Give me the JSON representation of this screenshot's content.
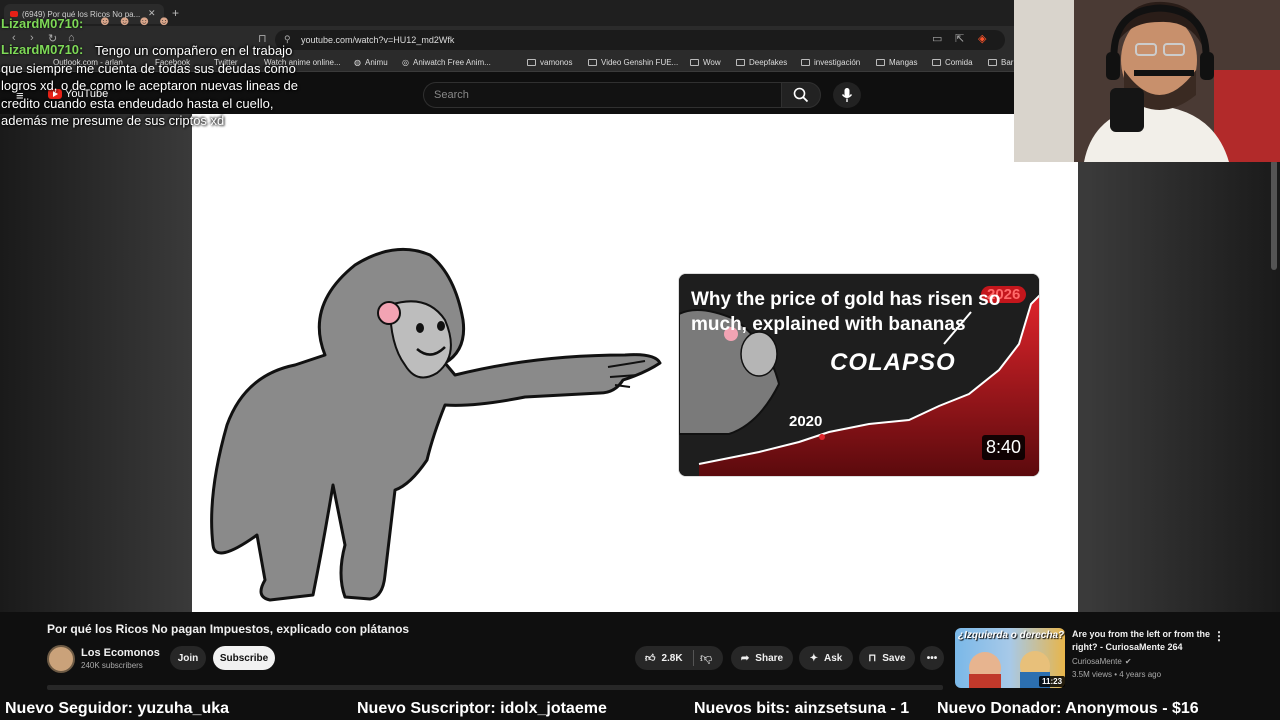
{
  "browser": {
    "tab_title": "(6949) Por qué los Ricos No pa...",
    "url": "youtube.com/watch?v=HU12_md2Wfk",
    "bookmarks": [
      "Outlook.com - arlan",
      "Facebook",
      "Twitter",
      "Watch anime online...",
      "Animu",
      "Aniwatch Free Anim...",
      "vamonos",
      "Video Genshin FUE...",
      "Wow",
      "Deepfakes",
      "investigación",
      "Mangas",
      "Comida",
      "Bar"
    ]
  },
  "youtube": {
    "logo_text": "YouTube",
    "search_placeholder": "Search"
  },
  "chat": {
    "username_1": "LizardM0710:",
    "username_2": "LizardM0710:",
    "message": "Tengo un compañero en el trabajo que siempre me cuenta de todas sus deudas como logros xd, o de como le aceptaron nuevas lineas de credito cuando esta endeudado hasta el cuello, además me presume de sus criptos xd"
  },
  "video_thumbnail_in_frame": {
    "title": "Why the price of gold has risen so much, explained with bananas",
    "overlay_word": "COLAPSO",
    "year_start": "2020",
    "year_end": "2026",
    "duration": "8:40"
  },
  "video": {
    "title": "Por qué los Ricos No pagan Impuestos, explicado con plátanos",
    "channel": "Los Ecomonos",
    "subscribers": "240K subscribers",
    "join_label": "Join",
    "subscribe_label": "Subscribe",
    "likes": "2.8K",
    "share_label": "Share",
    "ask_label": "Ask",
    "save_label": "Save",
    "more_label": "•••"
  },
  "recommended": {
    "thumb_text": "¿Izquierda o derecha?",
    "duration": "11:23",
    "title": "Are you from the left or from the right? - CuriosaMente 264",
    "channel": "CuriosaMente",
    "meta": "3.5M views • 4 years ago"
  },
  "ticker": {
    "follower": "Nuevo Seguidor: yuzuha_uka",
    "subscriber": "Nuevo Suscriptor: idolx_jotaeme",
    "bits": "Nuevos bits: ainzsetsuna - 1",
    "donor": "Nuevo Donador: Anonymous - $16"
  },
  "colors": {
    "youtube_red": "#e62117",
    "chat_username": "#7ed957",
    "background": "#0f0f0f"
  }
}
